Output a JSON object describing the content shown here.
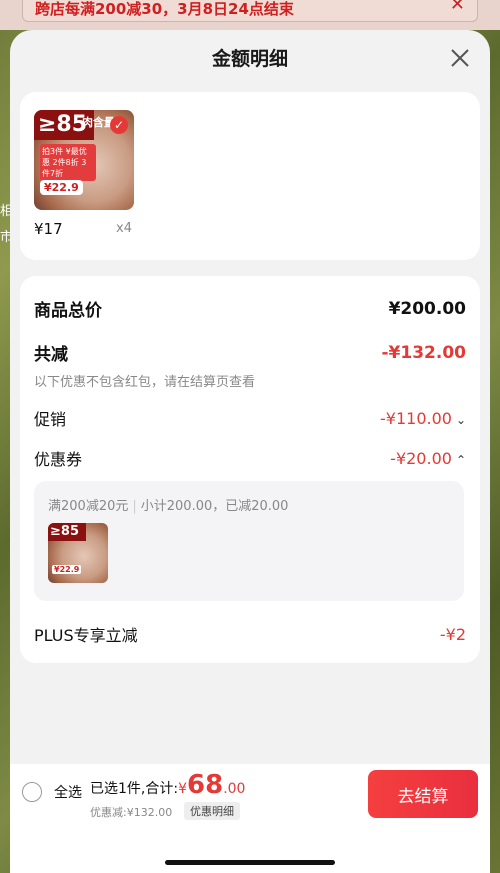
{
  "banner": {
    "text": "跨店每满200减30，3月8日24点结束",
    "close": "✕"
  },
  "side": {
    "char1": "相",
    "char2": "市"
  },
  "sheet": {
    "title": "金额明细",
    "item": {
      "price": "¥17",
      "qty": "x4",
      "thumb": {
        "tag": "≥85",
        "tag2": "肉含量",
        "promo": "拍3件 ¥最优惠 2件8折 3件7折",
        "price": "¥22.9"
      }
    },
    "summary": {
      "total_label": "商品总价",
      "total_value": "¥200.00",
      "reduce_label": "共减",
      "reduce_value": "-¥132.00",
      "note": "以下优惠不包含红包，请在结算页查看",
      "promo_label": "促销",
      "promo_value": "-¥110.00",
      "coupon_label": "优惠券",
      "coupon_value": "-¥20.00",
      "coupon_detail": {
        "rule": "满200减20元",
        "sub": "小计200.00，已减20.00",
        "thumb": {
          "tag": "≥85",
          "price": "¥22.9"
        }
      },
      "plus_label": "PLUS专享立减",
      "plus_value": "-¥2"
    }
  },
  "bottom": {
    "select_all": "全选",
    "selected_text": "已选1件,合计:",
    "currency": "¥",
    "amount_int": "68",
    "amount_dec": ".00",
    "discount": "优惠减:¥132.00",
    "detail": "优惠明细",
    "checkout": "去结算"
  },
  "colors": {
    "accent": "#e53935",
    "checkout_bg": "#f43f3f"
  }
}
